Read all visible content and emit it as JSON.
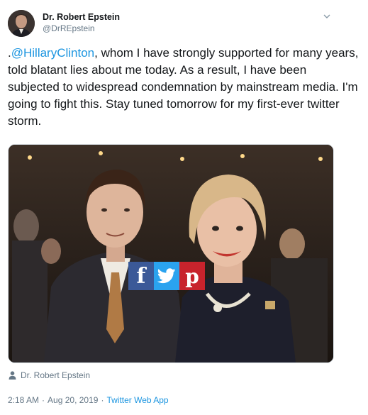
{
  "author": {
    "display_name": "Dr. Robert Epstein",
    "handle": "@DrREpstein"
  },
  "tweet": {
    "text_prefix": ".",
    "mention": "@HillaryClinton",
    "text_rest": ", whom I have strongly supported for many years, told blatant lies about me today. As a result, I have been subjected to widespread condemnation by mainstream media. I'm going to fight this. Stay tuned tomorrow for my first-ever twitter storm."
  },
  "media": {
    "share_buttons": [
      {
        "icon": "facebook-icon",
        "glyph": "f",
        "color": "#3b5998"
      },
      {
        "icon": "twitter-bird-icon",
        "glyph": "",
        "color": "#2aa3ef"
      },
      {
        "icon": "pinterest-icon",
        "glyph": "p",
        "color": "#c8232c"
      }
    ],
    "credit": "Dr. Robert Epstein"
  },
  "meta": {
    "time": "2:18 AM",
    "separator": "·",
    "date": "Aug 20, 2019",
    "source": "Twitter Web App"
  },
  "colors": {
    "link": "#1b95e0",
    "secondary_text": "#657786",
    "primary_text": "#14171a"
  }
}
